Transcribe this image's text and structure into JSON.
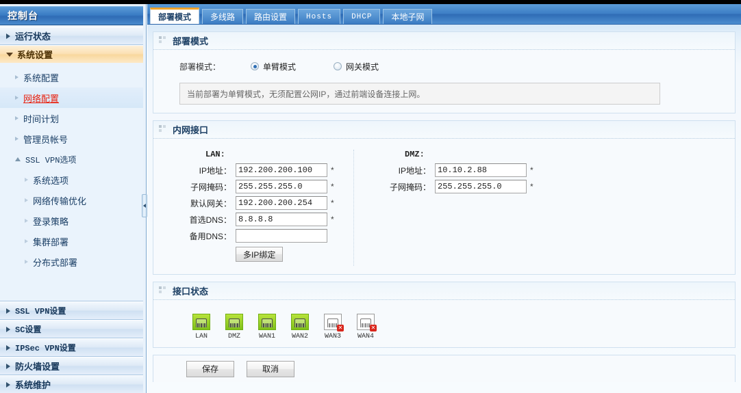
{
  "sidebar": {
    "title": "控制台",
    "groups": [
      {
        "label": "运行状态",
        "expanded": false
      },
      {
        "label": "系统设置",
        "expanded": true,
        "items": [
          {
            "label": "系统配置",
            "current": false
          },
          {
            "label": "网络配置",
            "current": true
          },
          {
            "label": "时间计划",
            "current": false
          },
          {
            "label": "管理员帐号",
            "current": false
          },
          {
            "label": "SSL VPN选项",
            "expandable": true,
            "children": [
              {
                "label": "系统选项"
              },
              {
                "label": "网络传输优化"
              },
              {
                "label": "登录策略"
              },
              {
                "label": "集群部署"
              },
              {
                "label": "分布式部署"
              }
            ]
          }
        ]
      },
      {
        "label": "SSL VPN设置",
        "expanded": false
      },
      {
        "label": "SC设置",
        "expanded": false
      },
      {
        "label": "IPSec VPN设置",
        "expanded": false
      },
      {
        "label": "防火墙设置",
        "expanded": false
      },
      {
        "label": "系统维护",
        "expanded": false
      }
    ]
  },
  "tabs": [
    {
      "label": "部署模式",
      "active": true,
      "mono": false
    },
    {
      "label": "多线路",
      "active": false,
      "mono": false
    },
    {
      "label": "路由设置",
      "active": false,
      "mono": false
    },
    {
      "label": "Hosts",
      "active": false,
      "mono": true
    },
    {
      "label": "DHCP",
      "active": false,
      "mono": true
    },
    {
      "label": "本地子网",
      "active": false,
      "mono": false
    }
  ],
  "deployment": {
    "section_title": "部署模式",
    "field_label": "部署模式：",
    "options": [
      {
        "label": "单臂模式",
        "selected": true
      },
      {
        "label": "网关模式",
        "selected": false
      }
    ],
    "note": "当前部署为单臂模式，无须配置公网IP，通过前端设备连接上网。"
  },
  "lan_section": {
    "section_title": "内网接口",
    "lan": {
      "title": "LAN:",
      "fields": [
        {
          "label": "IP地址：",
          "value": "192.200.200.100",
          "required": "*"
        },
        {
          "label": "子网掩码：",
          "value": "255.255.255.0",
          "required": "*"
        },
        {
          "label": "默认网关：",
          "value": "192.200.200.254",
          "required": "*"
        },
        {
          "label": "首选DNS：",
          "value": "8.8.8.8",
          "required": "*"
        },
        {
          "label": "备用DNS：",
          "value": "",
          "required": ""
        }
      ],
      "multi_ip_button": "多IP绑定"
    },
    "dmz": {
      "title": "DMZ:",
      "fields": [
        {
          "label": "IP地址：",
          "value": "10.10.2.88",
          "required": "*"
        },
        {
          "label": "子网掩码：",
          "value": "255.255.255.0",
          "required": "*"
        }
      ]
    }
  },
  "interface_status": {
    "section_title": "接口状态",
    "interfaces": [
      {
        "name": "LAN",
        "status": "up"
      },
      {
        "name": "DMZ",
        "status": "up"
      },
      {
        "name": "WAN1",
        "status": "up"
      },
      {
        "name": "WAN2",
        "status": "up"
      },
      {
        "name": "WAN3",
        "status": "down"
      },
      {
        "name": "WAN4",
        "status": "down"
      }
    ]
  },
  "footer": {
    "save_label": "保存",
    "cancel_label": "取消"
  },
  "colors": {
    "header_blue": "#3a7cc4",
    "active_tab_accent": "#f0a32a",
    "current_item_red": "#e8210f",
    "active_group_orange": "#f8d79c",
    "link_up_green": "#7fc01a",
    "badge_red": "#d9261c"
  }
}
